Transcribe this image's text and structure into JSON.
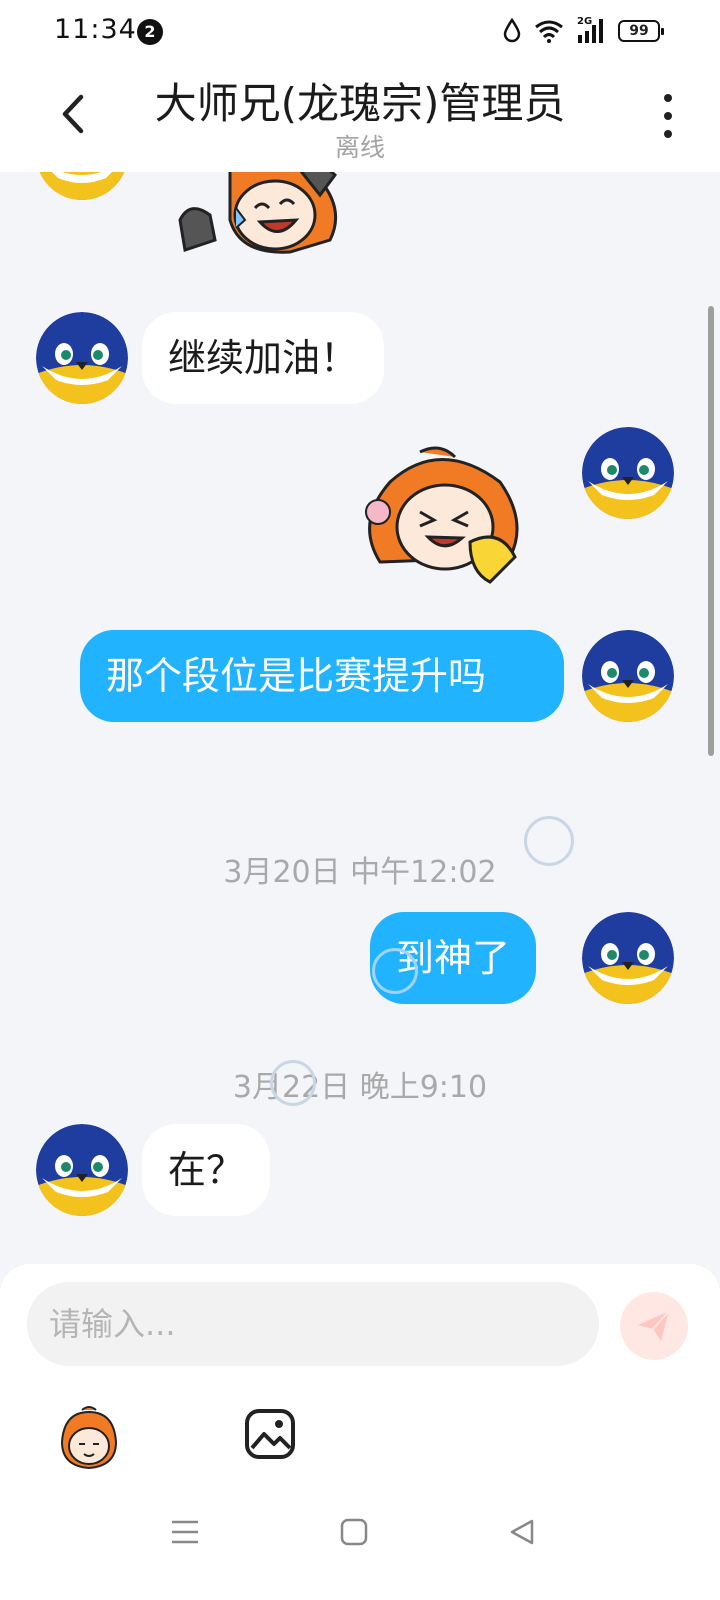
{
  "status_bar": {
    "time": "11:34",
    "notification_count": "2",
    "network_label": "2G",
    "battery_level": "99"
  },
  "header": {
    "title": "大师兄(龙瑰宗)管理员",
    "subtitle": "离线"
  },
  "messages": [
    {
      "type": "sticker",
      "side": "incoming",
      "sticker_icon": "laughing-girl-sticker-icon"
    },
    {
      "type": "text",
      "side": "incoming",
      "text": "继续加油！"
    },
    {
      "type": "sticker",
      "side": "outgoing",
      "sticker_icon": "shy-girl-sticker-icon"
    },
    {
      "type": "text",
      "side": "outgoing",
      "text": "那个段位是比赛提升吗"
    },
    {
      "type": "timestamp",
      "text": "3月20日 中午12:02"
    },
    {
      "type": "text",
      "side": "outgoing",
      "text": "到神了"
    },
    {
      "type": "timestamp",
      "text": "3月22日 晚上9:10"
    },
    {
      "type": "text",
      "side": "incoming",
      "text": "在？"
    }
  ],
  "composer": {
    "placeholder": "请输入...",
    "value": "",
    "send_icon": "send-icon",
    "emoji_icon": "emoji-sticker-icon",
    "image_icon": "image-icon"
  },
  "colors": {
    "outgoing_bubble": "#22b3ff",
    "incoming_bubble": "#ffffff",
    "chat_background": "#f3f5f9",
    "send_button_bg": "#ffe7e4"
  },
  "navigation": {
    "menu_icon": "menu-icon",
    "home_icon": "home-icon",
    "back_icon": "back-triangle-icon"
  }
}
